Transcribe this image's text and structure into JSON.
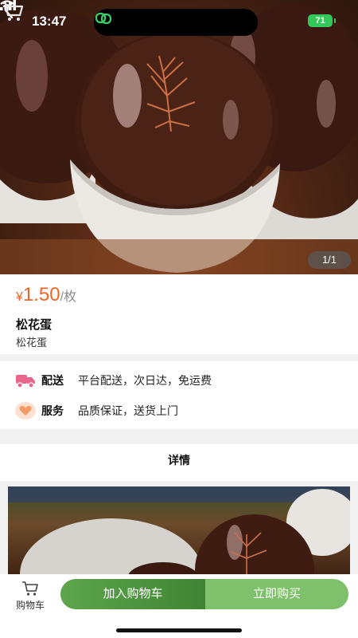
{
  "status": {
    "time": "13:47",
    "battery": "71"
  },
  "gallery": {
    "pager": "1/1"
  },
  "product": {
    "currency": "¥",
    "price": "1.50",
    "unit": "/枚",
    "name": "松花蛋",
    "subtitle": "松花蛋"
  },
  "services": [
    {
      "label": "配送",
      "value": "平台配送，次日达，免运费",
      "icon": "delivery-truck-icon"
    },
    {
      "label": "服务",
      "value": "品质保证，送货上门",
      "icon": "heart-icon"
    }
  ],
  "detail": {
    "header": "详情"
  },
  "bottom_bar": {
    "cart_label": "购物车",
    "add_to_cart": "加入购物车",
    "buy_now": "立即购买"
  },
  "colors": {
    "accent": "#f06525",
    "primary_green": "#4a9a3c",
    "light_green": "#7fc06a"
  }
}
